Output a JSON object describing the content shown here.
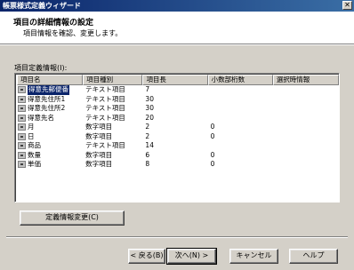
{
  "window": {
    "title": "帳票様式定義ウィザード",
    "close_glyph": "✕"
  },
  "header": {
    "title": "項目の詳細情報の設定",
    "subtitle": "項目情報を確認、変更します。"
  },
  "list": {
    "label": "項目定義情報(I):",
    "columns": [
      "項目名",
      "項目種別",
      "項目長",
      "小数部桁数",
      "選択時情報"
    ],
    "rows": [
      {
        "name": "得意先郵便番",
        "kind": "テキスト項目",
        "length": "7",
        "decimals": "",
        "selected": true
      },
      {
        "name": "得意先住所1",
        "kind": "テキスト項目",
        "length": "30",
        "decimals": ""
      },
      {
        "name": "得意先住所2",
        "kind": "テキスト項目",
        "length": "30",
        "decimals": ""
      },
      {
        "name": "得意先名",
        "kind": "テキスト項目",
        "length": "20",
        "decimals": ""
      },
      {
        "name": "月",
        "kind": "数字項目",
        "length": "2",
        "decimals": "0"
      },
      {
        "name": "日",
        "kind": "数字項目",
        "length": "2",
        "decimals": "0"
      },
      {
        "name": "商品",
        "kind": "テキスト項目",
        "length": "14",
        "decimals": ""
      },
      {
        "name": "数量",
        "kind": "数字項目",
        "length": "6",
        "decimals": "0"
      },
      {
        "name": "単価",
        "kind": "数字項目",
        "length": "8",
        "decimals": "0"
      }
    ]
  },
  "buttons": {
    "definition_change": "定義情報変更(C)",
    "back": "< 戻る(B)",
    "next": "次へ(N) >",
    "cancel": "キャンセル",
    "help": "ヘルプ"
  },
  "colors": {
    "title_bar": "#0a246a",
    "face": "#d4d0c8",
    "selection": "#0a246a"
  }
}
